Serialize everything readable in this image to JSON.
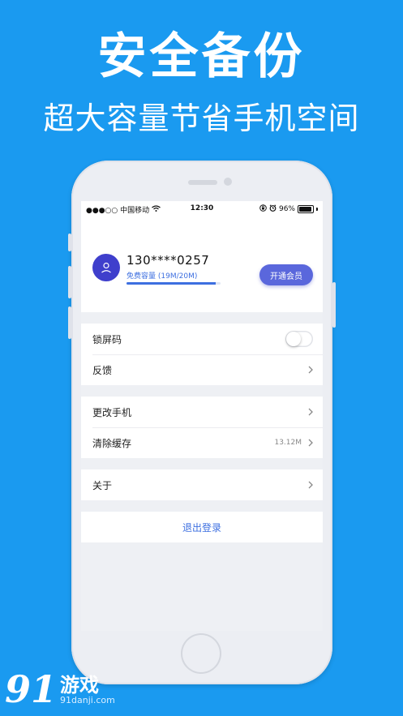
{
  "hero": {
    "title": "安全备份",
    "subtitle": "超大容量节省手机空间"
  },
  "status_bar": {
    "carrier": "●●●○○ 中国移动",
    "time": "12:30",
    "battery_text": "96%",
    "battery_level": 0.96,
    "icons": [
      "wifi-icon",
      "lock-rotation-icon",
      "alarm-icon",
      "battery-icon"
    ]
  },
  "profile": {
    "phone_number": "130****0257",
    "quota_label": "免费容量 (19M/20M)",
    "quota_fraction": 0.95,
    "vip_button": "开通会员"
  },
  "settings": {
    "lock_screen": {
      "label": "锁屏码",
      "enabled": false
    },
    "feedback": {
      "label": "反馈"
    },
    "change_phone": {
      "label": "更改手机"
    },
    "clear_cache": {
      "label": "清除缓存",
      "value": "13.12M"
    },
    "about": {
      "label": "关于"
    },
    "logout": "退出登录"
  },
  "watermark": {
    "number": "91",
    "brand": "游戏",
    "url": "91danji.com"
  },
  "colors": {
    "background": "#1a9af0",
    "accent": "#3d6fe0",
    "avatar": "#3f3fcc",
    "vip_button": "#5a67dc"
  }
}
